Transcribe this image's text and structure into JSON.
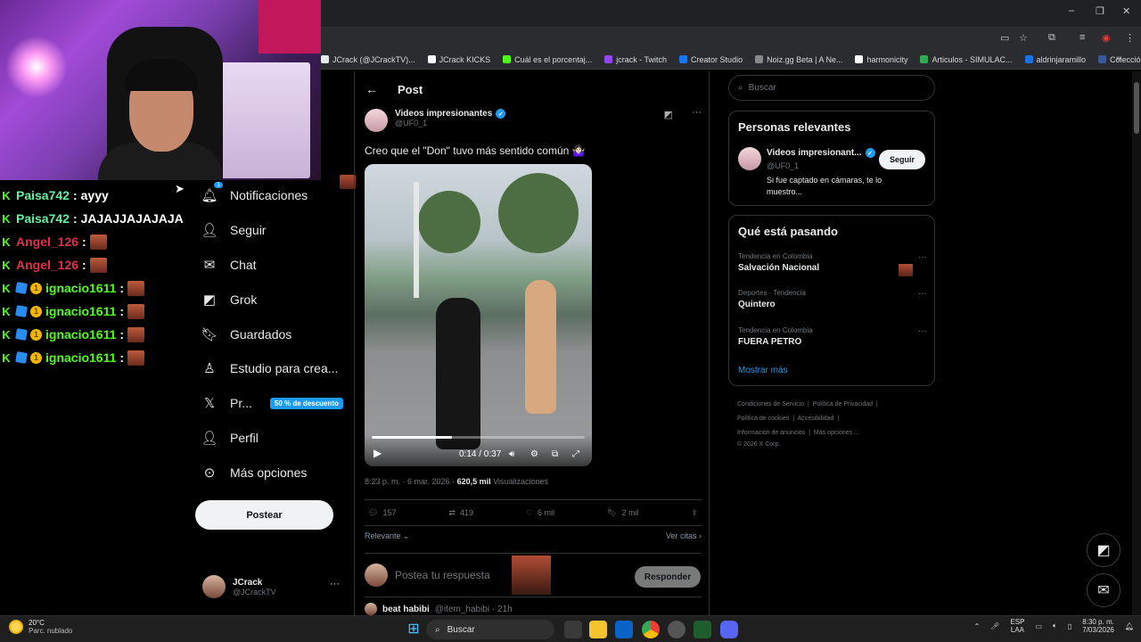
{
  "bookmarks": [
    {
      "label": "JCrack (@JCrackTV)...",
      "color": "#e7e9ea"
    },
    {
      "label": "JCrack KICKS",
      "color": "#ffffff"
    },
    {
      "label": "Cuál es el porcentaj...",
      "color": "#53fc18"
    },
    {
      "label": "jcrack - Twitch",
      "color": "#9146ff"
    },
    {
      "label": "Creator Studio",
      "color": "#1877f2"
    },
    {
      "label": "Noiz.gg Beta | A Ne...",
      "color": "#888888"
    },
    {
      "label": "harmonicity",
      "color": "#ffffff"
    },
    {
      "label": "Articulos - SIMULAC...",
      "color": "#34a853"
    },
    {
      "label": "aldrinjaramillo",
      "color": "#1a73e8"
    },
    {
      "label": "Colección de M_blei...",
      "color": "#3a5a9a"
    }
  ],
  "chat": [
    {
      "user": "Paisa742",
      "color": "#65f0a4",
      "message": "ayyy",
      "badges": "k",
      "emote": false
    },
    {
      "user": "Paisa742",
      "color": "#65f0a4",
      "message": "JAJAJJAJAJAJA",
      "badges": "k",
      "emote": false
    },
    {
      "user": "Angel_126",
      "color": "#e0314b",
      "message": "",
      "badges": "k",
      "emote": true
    },
    {
      "user": "Angel_126",
      "color": "#e0314b",
      "message": "",
      "badges": "k",
      "emote": true
    },
    {
      "user": "ignacio1611",
      "color": "#53fc18",
      "message": "",
      "badges": "k-cube-coin",
      "emote": true
    },
    {
      "user": "ignacio1611",
      "color": "#53fc18",
      "message": "",
      "badges": "k-cube-coin",
      "emote": true
    },
    {
      "user": "ignacio1611",
      "color": "#53fc18",
      "message": "",
      "badges": "k-cube-coin",
      "emote": true
    },
    {
      "user": "ignacio1611",
      "color": "#53fc18",
      "message": "",
      "badges": "k-cube-coin",
      "emote": true
    }
  ],
  "nav": {
    "notifications": "Notificaciones",
    "notification_count": "1",
    "follow": "Seguir",
    "chat": "Chat",
    "grok": "Grok",
    "saved": "Guardados",
    "studio": "Estudio para crea...",
    "premium": "Pr...",
    "premium_badge": "50 % de descuento",
    "profile": "Perfil",
    "more": "Más opciones",
    "post_button": "Postear"
  },
  "account": {
    "name": "JCrack",
    "handle": "@JCrackTV"
  },
  "post": {
    "header": "Post",
    "author_name": "Videos impresionantes",
    "author_handle": "@UF0_1",
    "text": "Creo que el \"Don\" tuvo más sentido común 🤷🏻‍♀️",
    "video_time": "0:14 / 0:37",
    "video_progress": 0.378,
    "meta_time": "8:23 p. m. · 6 mar. 2026 · ",
    "views_count": "620,5 mil",
    "views_label": " Visualizaciones",
    "replies": "157",
    "reposts": "419",
    "likes": "6 mil",
    "bookmarks": "2 mil",
    "sort_label": "Relevante",
    "quotes_label": "Ver citas",
    "reply_placeholder": "Postea tu respuesta",
    "reply_button": "Responder",
    "next_author": "beat habibi",
    "next_meta": "@item_habibi · 21h"
  },
  "sidebar": {
    "search_placeholder": "Buscar",
    "relevant_title": "Personas relevantes",
    "relevant_name": "Videos impresionant...",
    "relevant_handle": "@UF0_1",
    "relevant_bio": "Si fue captado en cámaras, te lo muestro...",
    "follow_button": "Seguir",
    "trends_title": "Qué está pasando",
    "trends": [
      {
        "category": "Tendencia en Colombia",
        "name": "Salvación Nacional"
      },
      {
        "category": "Deportes · Tendencia",
        "name": "Quintero"
      },
      {
        "category": "Tendencia en Colombia",
        "name": "FUERA PETRO"
      }
    ],
    "show_more": "Mostrar más",
    "footer": [
      "Condiciones de Servicio",
      "Política de Privacidad",
      "Política de cookies",
      "Accesibilidad",
      "Información de anuncios",
      "Más opciones ...",
      "© 2026 X Corp."
    ]
  },
  "taskbar": {
    "temperature": "20°C",
    "weather": "Parc. nublado",
    "search": "Buscar",
    "lang": "ESP",
    "lang2": "LAA",
    "time": "8:30 p. m.",
    "date": "7/03/2026"
  }
}
